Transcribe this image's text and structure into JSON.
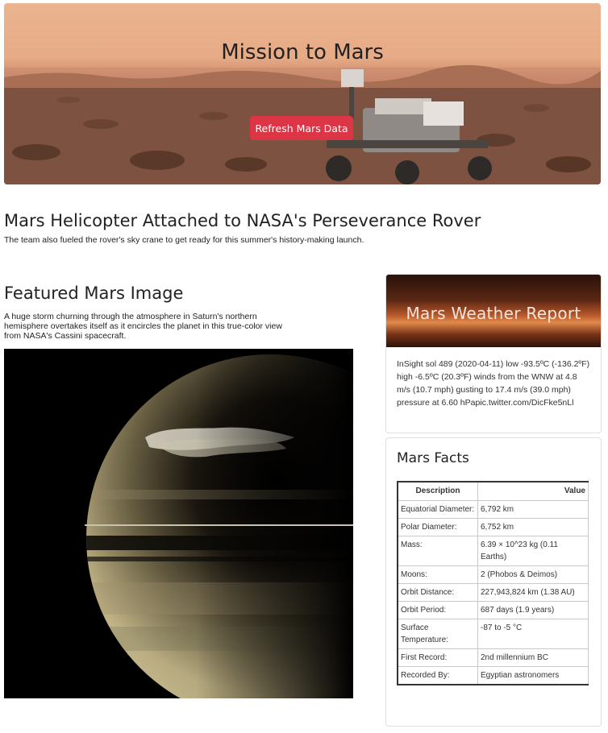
{
  "header": {
    "title": "Mission to Mars",
    "refresh_label": "Refresh Mars Data"
  },
  "news": {
    "title": "Mars Helicopter Attached to NASA's Perseverance Rover",
    "teaser": "The team also fueled the rover's sky crane to get ready for this summer's history-making launch."
  },
  "featured": {
    "heading": "Featured Mars Image",
    "caption": "A huge storm churning through the atmosphere in Saturn's northern hemisphere overtakes itself as it encircles the planet in this true-color view from NASA's Cassini spacecraft."
  },
  "weather": {
    "heading": "Mars Weather Report",
    "text": "InSight sol 489 (2020-04-11) low -93.5ºC (-136.2ºF) high -6.5ºC (20.3ºF) winds from the WNW at 4.8 m/s (10.7 mph) gusting to 17.4 m/s (39.0 mph) pressure at 6.60 hPapic.twitter.com/DicFke5nLl"
  },
  "facts": {
    "heading": "Mars Facts",
    "col_description": "Description",
    "col_value": "Value",
    "rows": [
      {
        "label": "Equatorial Diameter:",
        "value": "6,792 km"
      },
      {
        "label": "Polar Diameter:",
        "value": "6,752 km"
      },
      {
        "label": "Mass:",
        "value": "6.39 × 10^23 kg (0.11 Earths)"
      },
      {
        "label": "Moons:",
        "value": "2 (Phobos & Deimos)"
      },
      {
        "label": "Orbit Distance:",
        "value": "227,943,824 km (1.38 AU)"
      },
      {
        "label": "Orbit Period:",
        "value": "687 days (1.9 years)"
      },
      {
        "label": "Surface Temperature:",
        "value": "-87 to -5 °C"
      },
      {
        "label": "First Record:",
        "value": "2nd millennium BC"
      },
      {
        "label": "Recorded By:",
        "value": "Egyptian astronomers"
      }
    ]
  }
}
